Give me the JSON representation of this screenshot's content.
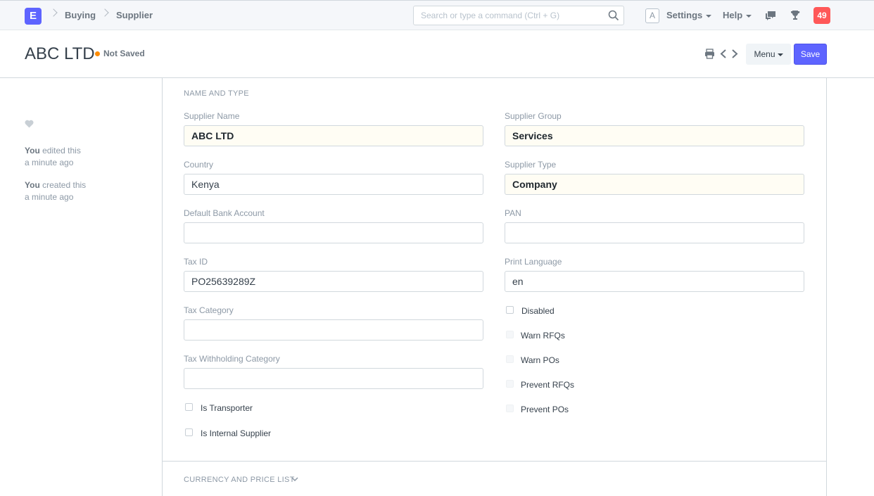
{
  "navbar": {
    "logo": "E",
    "breadcrumbs": [
      "Buying",
      "Supplier"
    ],
    "search_placeholder": "Search or type a command (Ctrl + G)",
    "avatar": "A",
    "settings": "Settings",
    "help": "Help",
    "notifications": "49"
  },
  "page": {
    "title": "ABC LTD",
    "status": "Not Saved",
    "menu": "Menu",
    "save": "Save"
  },
  "sidebar": {
    "timeline": [
      {
        "who": "You",
        "action": "edited this",
        "when": "a minute ago"
      },
      {
        "who": "You",
        "action": "created this",
        "when": "a minute ago"
      }
    ]
  },
  "form": {
    "section1": "NAME AND TYPE",
    "left": [
      {
        "label": "Supplier Name",
        "value": "ABC LTD"
      },
      {
        "label": "Country",
        "value": "Kenya"
      },
      {
        "label": "Default Bank Account",
        "value": ""
      },
      {
        "label": "Tax ID",
        "value": "PO25639289Z"
      },
      {
        "label": "Tax Category",
        "value": ""
      },
      {
        "label": "Tax Withholding Category",
        "value": ""
      }
    ],
    "right": [
      {
        "label": "Supplier Group",
        "value": "Services"
      },
      {
        "label": "Supplier Type",
        "value": "Company"
      },
      {
        "label": "PAN",
        "value": ""
      },
      {
        "label": "Print Language",
        "value": "en"
      }
    ],
    "left_checks": [
      "Is Transporter",
      "Is Internal Supplier"
    ],
    "right_checks": [
      "Disabled",
      "Warn RFQs",
      "Warn POs",
      "Prevent RFQs",
      "Prevent POs"
    ],
    "section2": "CURRENCY AND PRICE LIST"
  },
  "colors": {
    "accent": "#5e64ff",
    "indicator": "#ff8c00",
    "notification": "#ff5858"
  }
}
